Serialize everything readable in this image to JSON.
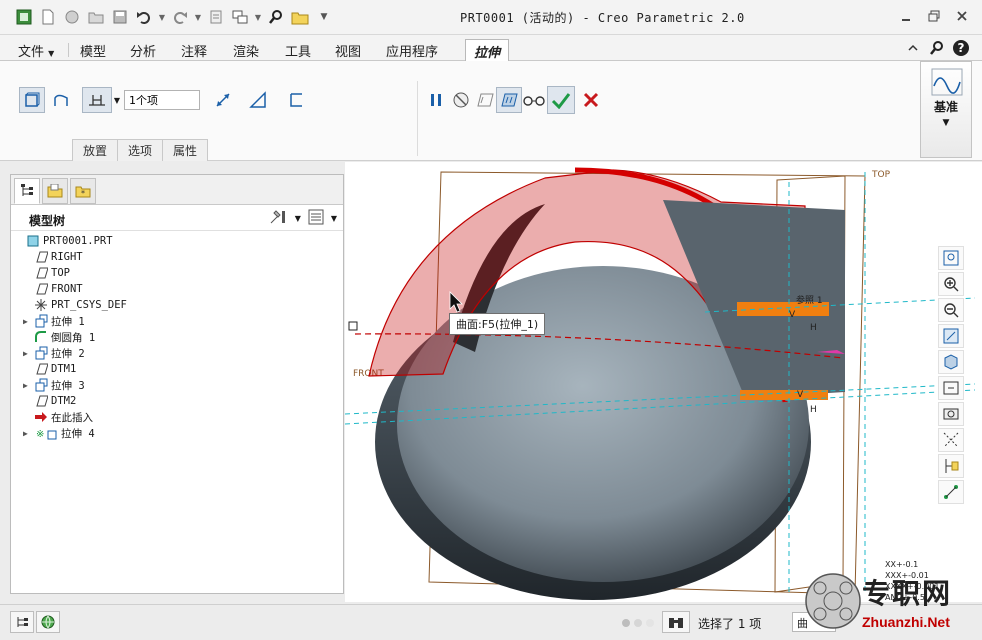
{
  "window": {
    "title": "PRT0001 (活动的) - Creo Parametric 2.0"
  },
  "ribbon_tabs": [
    {
      "label": "文件",
      "has_dropdown": true
    },
    {
      "label": "模型"
    },
    {
      "label": "分析"
    },
    {
      "label": "注释"
    },
    {
      "label": "渲染"
    },
    {
      "label": "工具"
    },
    {
      "label": "视图"
    },
    {
      "label": "应用程序"
    },
    {
      "label": "拉伸",
      "active": true
    }
  ],
  "extrude": {
    "depth_value": "1个项",
    "subtabs": [
      "放置",
      "选项",
      "属性"
    ]
  },
  "datum_group": {
    "label": "基准"
  },
  "model_tree": {
    "title": "模型树",
    "nodes": [
      {
        "label": "PRT0001.PRT",
        "icon": "part-icon",
        "expandable": false,
        "indent": 0
      },
      {
        "label": "RIGHT",
        "icon": "datum-plane-icon",
        "expandable": false,
        "indent": 1
      },
      {
        "label": "TOP",
        "icon": "datum-plane-icon",
        "expandable": false,
        "indent": 1
      },
      {
        "label": "FRONT",
        "icon": "datum-plane-icon",
        "expandable": false,
        "indent": 1
      },
      {
        "label": "PRT_CSYS_DEF",
        "icon": "csys-icon",
        "expandable": false,
        "indent": 1
      },
      {
        "label": "拉伸 1",
        "icon": "extrude-icon",
        "expandable": true,
        "indent": 1
      },
      {
        "label": "倒圆角 1",
        "icon": "round-icon",
        "expandable": false,
        "indent": 1
      },
      {
        "label": "拉伸 2",
        "icon": "extrude-icon",
        "expandable": true,
        "indent": 1
      },
      {
        "label": "DTM1",
        "icon": "datum-plane-icon",
        "expandable": false,
        "indent": 1
      },
      {
        "label": "拉伸 3",
        "icon": "extrude-icon",
        "expandable": true,
        "indent": 1
      },
      {
        "label": "DTM2",
        "icon": "datum-plane-icon",
        "expandable": false,
        "indent": 1
      },
      {
        "label": "在此插入",
        "icon": "insert-here-icon",
        "expandable": false,
        "indent": 1
      },
      {
        "label": "拉伸 4",
        "icon": "extrude-active-icon",
        "expandable": true,
        "indent": 1
      }
    ]
  },
  "graphics": {
    "tooltip": "曲面:F5(拉伸_1)",
    "plane_labels": [
      "TOP",
      "FRONT"
    ],
    "dim_labels": [
      "V",
      "H",
      "V",
      "H",
      "参照 1"
    ],
    "tolerances": [
      "XX+-0.1",
      "XXX+-0.01",
      "XXXX+-0.001",
      "ANG+-0.5"
    ]
  },
  "status": {
    "selection_text": "选择了 1 项",
    "filter_value": "曲"
  },
  "watermark": {
    "cn": "专职网",
    "en": "Zhuanzhi.Net"
  },
  "colors": {
    "model_gray": "#7b8994",
    "highlight_red": "#c00000",
    "orange": "#f07f10",
    "plane_brown": "#8c5a2b",
    "axis_cyan": "#1fb8c8",
    "accent_blue": "#1a5fa8"
  }
}
